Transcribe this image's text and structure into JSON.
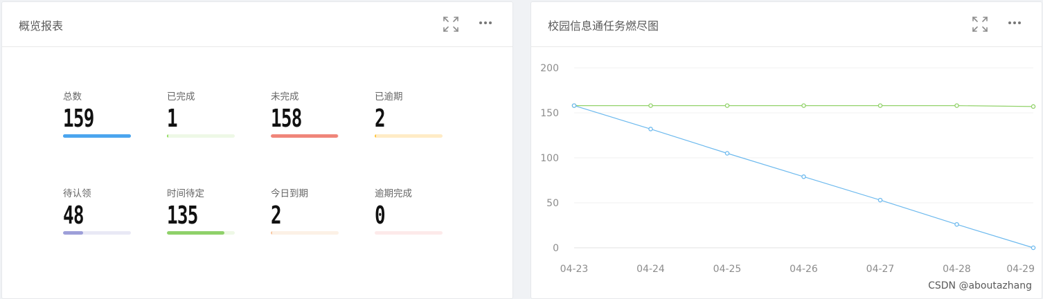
{
  "overview": {
    "title": "概览报表",
    "stats": [
      {
        "label": "总数",
        "value": "159",
        "progress": 1.0,
        "fill": "#4ba5ef",
        "track": "#4ba5ef"
      },
      {
        "label": "已完成",
        "value": "1",
        "progress": 0.006,
        "fill": "#95de64",
        "track": "#eef8e6"
      },
      {
        "label": "未完成",
        "value": "158",
        "progress": 0.994,
        "fill": "#f0857a",
        "track": "#fbe2df"
      },
      {
        "label": "已逾期",
        "value": "2",
        "progress": 0.013,
        "fill": "#ffc53d",
        "track": "#ffecc6"
      },
      {
        "label": "待认领",
        "value": "48",
        "progress": 0.3,
        "fill": "#9d9fd9",
        "track": "#e9e9f5"
      },
      {
        "label": "时间待定",
        "value": "135",
        "progress": 0.85,
        "fill": "#8fd16a",
        "track": "#eef8e6"
      },
      {
        "label": "今日到期",
        "value": "2",
        "progress": 0.013,
        "fill": "#f7c6a0",
        "track": "#fcf1e6"
      },
      {
        "label": "逾期完成",
        "value": "0",
        "progress": 0.0,
        "fill": "#ffb3b3",
        "track": "#fdeaea"
      }
    ]
  },
  "burndown": {
    "title": "校园信息通任务燃尽图",
    "watermark": "CSDN @aboutazhang"
  },
  "chart_data": {
    "type": "line",
    "title": "校园信息通任务燃尽图",
    "x": [
      "04-23",
      "04-24",
      "04-25",
      "04-26",
      "04-27",
      "04-28",
      "04-29"
    ],
    "yticks": [
      "0",
      "50",
      "100",
      "150",
      "200"
    ],
    "ylim": [
      0,
      200
    ],
    "grid": true,
    "series": [
      {
        "color": "#91d269",
        "values": [
          158,
          158,
          158,
          158,
          158,
          158,
          157
        ]
      },
      {
        "color": "#6cb9ee",
        "values": [
          158,
          132,
          105,
          79,
          53,
          26,
          0
        ]
      }
    ]
  },
  "icons": {
    "fullscreen": "fullscreen-icon",
    "more": "more-icon"
  }
}
